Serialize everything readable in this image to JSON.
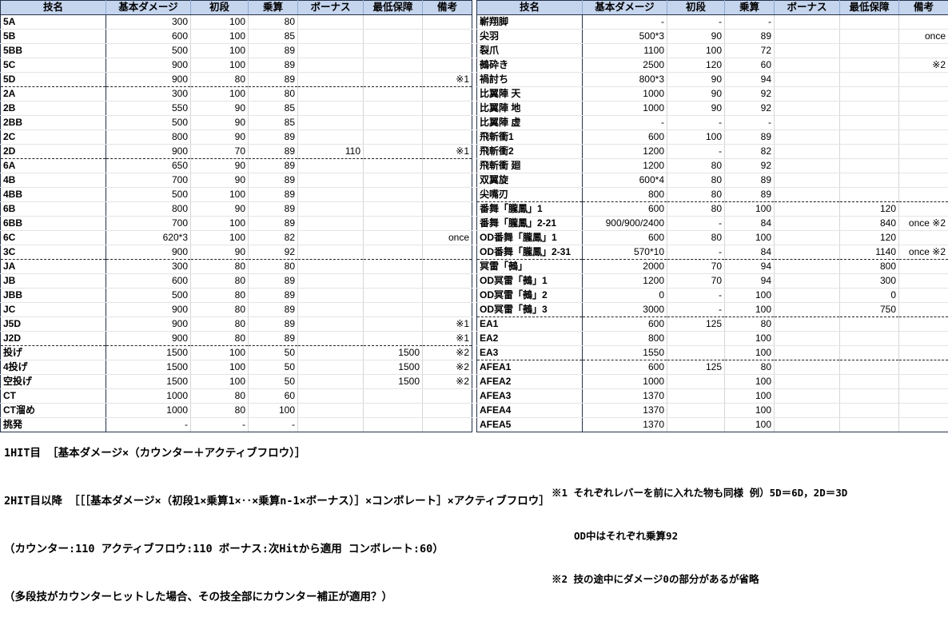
{
  "columns": [
    "技名",
    "基本ダメージ",
    "初段",
    "乗算",
    "ボーナス",
    "最低保障",
    "備考"
  ],
  "left_table": {
    "rows": [
      {
        "name": "5A",
        "base": "300",
        "first": "100",
        "mult": "80",
        "bonus": "",
        "min": "",
        "remark": "",
        "sep": false
      },
      {
        "name": "5B",
        "base": "600",
        "first": "100",
        "mult": "85",
        "bonus": "",
        "min": "",
        "remark": "",
        "sep": false
      },
      {
        "name": "5BB",
        "base": "500",
        "first": "100",
        "mult": "89",
        "bonus": "",
        "min": "",
        "remark": "",
        "sep": false
      },
      {
        "name": "5C",
        "base": "900",
        "first": "100",
        "mult": "89",
        "bonus": "",
        "min": "",
        "remark": "",
        "sep": false
      },
      {
        "name": "5D",
        "base": "900",
        "first": "80",
        "mult": "89",
        "bonus": "",
        "min": "",
        "remark": "※1",
        "sep": true
      },
      {
        "name": "2A",
        "base": "300",
        "first": "100",
        "mult": "80",
        "bonus": "",
        "min": "",
        "remark": "",
        "sep": false
      },
      {
        "name": "2B",
        "base": "550",
        "first": "90",
        "mult": "85",
        "bonus": "",
        "min": "",
        "remark": "",
        "sep": false
      },
      {
        "name": "2BB",
        "base": "500",
        "first": "90",
        "mult": "85",
        "bonus": "",
        "min": "",
        "remark": "",
        "sep": false
      },
      {
        "name": "2C",
        "base": "800",
        "first": "90",
        "mult": "89",
        "bonus": "",
        "min": "",
        "remark": "",
        "sep": false
      },
      {
        "name": "2D",
        "base": "900",
        "first": "70",
        "mult": "89",
        "bonus": "110",
        "min": "",
        "remark": "※1",
        "sep": true
      },
      {
        "name": "6A",
        "base": "650",
        "first": "90",
        "mult": "89",
        "bonus": "",
        "min": "",
        "remark": "",
        "sep": false
      },
      {
        "name": "4B",
        "base": "700",
        "first": "90",
        "mult": "89",
        "bonus": "",
        "min": "",
        "remark": "",
        "sep": false
      },
      {
        "name": "4BB",
        "base": "500",
        "first": "100",
        "mult": "89",
        "bonus": "",
        "min": "",
        "remark": "",
        "sep": false
      },
      {
        "name": "6B",
        "base": "800",
        "first": "90",
        "mult": "89",
        "bonus": "",
        "min": "",
        "remark": "",
        "sep": false
      },
      {
        "name": "6BB",
        "base": "700",
        "first": "100",
        "mult": "89",
        "bonus": "",
        "min": "",
        "remark": "",
        "sep": false
      },
      {
        "name": "6C",
        "base": "620*3",
        "first": "100",
        "mult": "82",
        "bonus": "",
        "min": "",
        "remark": "once",
        "sep": false
      },
      {
        "name": "3C",
        "base": "900",
        "first": "90",
        "mult": "92",
        "bonus": "",
        "min": "",
        "remark": "",
        "sep": true
      },
      {
        "name": "JA",
        "base": "300",
        "first": "80",
        "mult": "80",
        "bonus": "",
        "min": "",
        "remark": "",
        "sep": false
      },
      {
        "name": "JB",
        "base": "600",
        "first": "80",
        "mult": "89",
        "bonus": "",
        "min": "",
        "remark": "",
        "sep": false
      },
      {
        "name": "JBB",
        "base": "500",
        "first": "80",
        "mult": "89",
        "bonus": "",
        "min": "",
        "remark": "",
        "sep": false
      },
      {
        "name": "JC",
        "base": "900",
        "first": "80",
        "mult": "89",
        "bonus": "",
        "min": "",
        "remark": "",
        "sep": false
      },
      {
        "name": "J5D",
        "base": "900",
        "first": "80",
        "mult": "89",
        "bonus": "",
        "min": "",
        "remark": "※1",
        "sep": false
      },
      {
        "name": "J2D",
        "base": "900",
        "first": "80",
        "mult": "89",
        "bonus": "",
        "min": "",
        "remark": "※1",
        "sep": true
      },
      {
        "name": "投げ",
        "base": "1500",
        "first": "100",
        "mult": "50",
        "bonus": "",
        "min": "1500",
        "remark": "※2",
        "sep": false
      },
      {
        "name": "4投げ",
        "base": "1500",
        "first": "100",
        "mult": "50",
        "bonus": "",
        "min": "1500",
        "remark": "※2",
        "sep": false
      },
      {
        "name": "空投げ",
        "base": "1500",
        "first": "100",
        "mult": "50",
        "bonus": "",
        "min": "1500",
        "remark": "※2",
        "sep": false
      },
      {
        "name": "CT",
        "base": "1000",
        "first": "80",
        "mult": "60",
        "bonus": "",
        "min": "",
        "remark": "",
        "sep": false
      },
      {
        "name": "CT溜め",
        "base": "1000",
        "first": "80",
        "mult": "100",
        "bonus": "",
        "min": "",
        "remark": "",
        "sep": false
      },
      {
        "name": "挑発",
        "base": "-",
        "first": "-",
        "mult": "-",
        "bonus": "",
        "min": "",
        "remark": "",
        "sep": false
      }
    ]
  },
  "right_table": {
    "rows": [
      {
        "name": "嶄翔脚",
        "base": "-",
        "first": "-",
        "mult": "-",
        "bonus": "",
        "min": "",
        "remark": "",
        "sep": false
      },
      {
        "name": "尖羽",
        "base": "500*3",
        "first": "90",
        "mult": "89",
        "bonus": "",
        "min": "",
        "remark": "once",
        "sep": false
      },
      {
        "name": "裂爪",
        "base": "1100",
        "first": "100",
        "mult": "72",
        "bonus": "",
        "min": "",
        "remark": "",
        "sep": false
      },
      {
        "name": "鵺砕き",
        "base": "2500",
        "first": "120",
        "mult": "60",
        "bonus": "",
        "min": "",
        "remark": "※2",
        "sep": false
      },
      {
        "name": "禍討ち",
        "base": "800*3",
        "first": "90",
        "mult": "94",
        "bonus": "",
        "min": "",
        "remark": "",
        "sep": false
      },
      {
        "name": "比翼陣 天",
        "base": "1000",
        "first": "90",
        "mult": "92",
        "bonus": "",
        "min": "",
        "remark": "",
        "sep": false
      },
      {
        "name": "比翼陣 地",
        "base": "1000",
        "first": "90",
        "mult": "92",
        "bonus": "",
        "min": "",
        "remark": "",
        "sep": false
      },
      {
        "name": "比翼陣 虚",
        "base": "-",
        "first": "-",
        "mult": "-",
        "bonus": "",
        "min": "",
        "remark": "",
        "sep": false
      },
      {
        "name": "飛斬衝1",
        "base": "600",
        "first": "100",
        "mult": "89",
        "bonus": "",
        "min": "",
        "remark": "",
        "sep": false
      },
      {
        "name": "飛斬衝2",
        "base": "1200",
        "first": "-",
        "mult": "82",
        "bonus": "",
        "min": "",
        "remark": "",
        "sep": false
      },
      {
        "name": "飛斬衝 廻",
        "base": "1200",
        "first": "80",
        "mult": "92",
        "bonus": "",
        "min": "",
        "remark": "",
        "sep": false
      },
      {
        "name": "双翼旋",
        "base": "600*4",
        "first": "80",
        "mult": "89",
        "bonus": "",
        "min": "",
        "remark": "",
        "sep": false
      },
      {
        "name": "尖嘴刃",
        "base": "800",
        "first": "80",
        "mult": "89",
        "bonus": "",
        "min": "",
        "remark": "",
        "sep": true
      },
      {
        "name": "番舞「朧鳳」1",
        "base": "600",
        "first": "80",
        "mult": "100",
        "bonus": "",
        "min": "120",
        "remark": "",
        "sep": false
      },
      {
        "name": "番舞「朧鳳」2-21",
        "base": "900/900/2400",
        "first": "-",
        "mult": "84",
        "bonus": "",
        "min": "840",
        "remark": "once ※2",
        "sep": false
      },
      {
        "name": "OD番舞「朧鳳」1",
        "base": "600",
        "first": "80",
        "mult": "100",
        "bonus": "",
        "min": "120",
        "remark": "",
        "sep": false
      },
      {
        "name": "OD番舞「朧鳳」2-31",
        "base": "570*10",
        "first": "-",
        "mult": "84",
        "bonus": "",
        "min": "1140",
        "remark": "once ※2",
        "sep": true
      },
      {
        "name": "冥雷「鵺」",
        "base": "2000",
        "first": "70",
        "mult": "94",
        "bonus": "",
        "min": "800",
        "remark": "",
        "sep": false
      },
      {
        "name": "OD冥雷「鵺」1",
        "base": "1200",
        "first": "70",
        "mult": "94",
        "bonus": "",
        "min": "300",
        "remark": "",
        "sep": false
      },
      {
        "name": "OD冥雷「鵺」2",
        "base": "0",
        "first": "-",
        "mult": "100",
        "bonus": "",
        "min": "0",
        "remark": "",
        "sep": false
      },
      {
        "name": "OD冥雷「鵺」3",
        "base": "3000",
        "first": "-",
        "mult": "100",
        "bonus": "",
        "min": "750",
        "remark": "",
        "sep": true
      },
      {
        "name": "EA1",
        "base": "600",
        "first": "125",
        "mult": "80",
        "bonus": "",
        "min": "",
        "remark": "",
        "sep": false
      },
      {
        "name": "EA2",
        "base": "800",
        "first": "",
        "mult": "100",
        "bonus": "",
        "min": "",
        "remark": "",
        "sep": false
      },
      {
        "name": "EA3",
        "base": "1550",
        "first": "",
        "mult": "100",
        "bonus": "",
        "min": "",
        "remark": "",
        "sep": true
      },
      {
        "name": "AFEA1",
        "base": "600",
        "first": "125",
        "mult": "80",
        "bonus": "",
        "min": "",
        "remark": "",
        "sep": false
      },
      {
        "name": "AFEA2",
        "base": "1000",
        "first": "",
        "mult": "100",
        "bonus": "",
        "min": "",
        "remark": "",
        "sep": false
      },
      {
        "name": "AFEA3",
        "base": "1370",
        "first": "",
        "mult": "100",
        "bonus": "",
        "min": "",
        "remark": "",
        "sep": false
      },
      {
        "name": "AFEA4",
        "base": "1370",
        "first": "",
        "mult": "100",
        "bonus": "",
        "min": "",
        "remark": "",
        "sep": false
      },
      {
        "name": "AFEA5",
        "base": "1370",
        "first": "",
        "mult": "100",
        "bonus": "",
        "min": "",
        "remark": "",
        "sep": false
      }
    ]
  },
  "notes_left": {
    "line1": "1HIT目 ［基本ダメージ×（カウンター＋アクティブフロウ）］",
    "line2": "2HIT目以降 ［［［基本ダメージ×（初段1×乗算1×‥×乗算n-1×ボーナス）］×コンボレート］×アクティブフロウ］",
    "line3": "（カウンター:110 アクティブフロウ:110 ボーナス:次Hitから適用 コンボレート:60）",
    "line4": "（多段技がカウンターヒットした場合、その技全部にカウンター補正が適用？）"
  },
  "notes_right": {
    "line1": "※1 それぞれレバーを前に入れた物も同様 例）5D＝6D，2D＝3D",
    "line1b": "OD中はそれぞれ乗算92",
    "line2": "※2 技の途中にダメージ0の部分があるが省略"
  }
}
